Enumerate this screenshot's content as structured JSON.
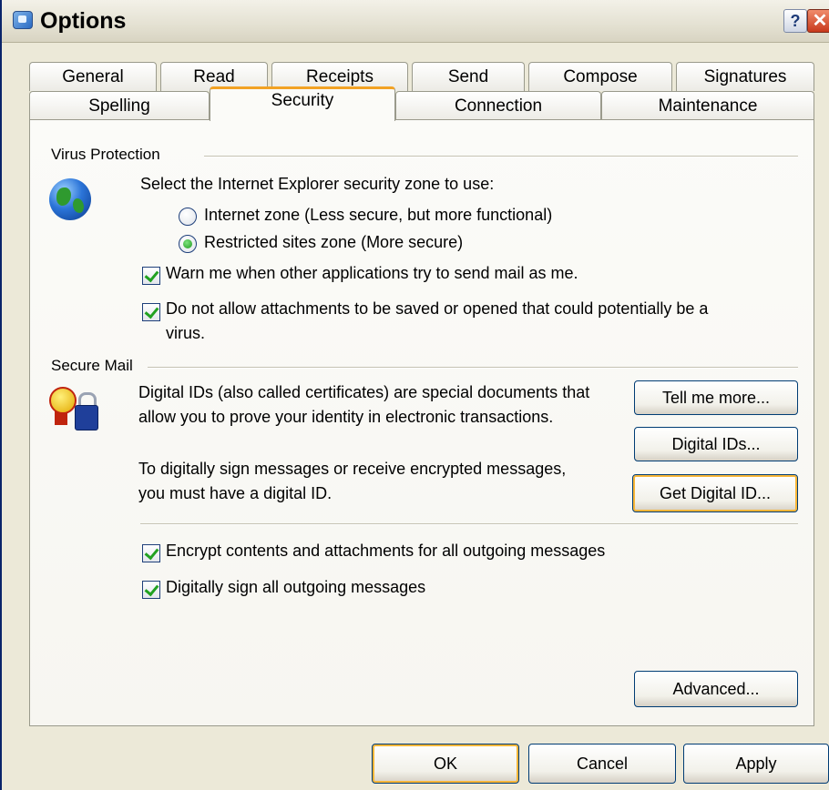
{
  "window": {
    "title": "Options",
    "help_glyph": "?",
    "close_glyph": "✕"
  },
  "tabs": {
    "row1": [
      "General",
      "Read",
      "Receipts",
      "Send",
      "Compose",
      "Signatures"
    ],
    "row2": [
      "Spelling",
      "Security",
      "Connection",
      "Maintenance"
    ],
    "active": "Security"
  },
  "virus_protection": {
    "heading": "Virus Protection",
    "icon": "globe-icon",
    "zone_prompt": "Select the Internet Explorer security zone to use:",
    "zones": [
      {
        "label": "Internet zone (Less secure, but more functional)",
        "selected": false
      },
      {
        "label": "Restricted sites zone (More secure)",
        "selected": true
      }
    ],
    "warn_label": "Warn me when other applications try to send mail as me.",
    "warn_checked": true,
    "attachments_label_line1": "Do not allow attachments to be saved or opened that could potentially be a",
    "attachments_label_line2": "virus.",
    "attachments_checked": true
  },
  "secure_mail": {
    "heading": "Secure Mail",
    "icon": "certificate-lock-icon",
    "desc1": "Digital IDs (also called certificates) are special documents that allow you to prove your identity in electronic transactions.",
    "desc2": "To digitally sign messages or receive encrypted messages, you must have a digital ID.",
    "tell_me_more": "Tell me more...",
    "digital_ids": "Digital IDs...",
    "get_digital_id": "Get Digital ID...",
    "encrypt_label": "Encrypt contents and attachments for all outgoing messages",
    "encrypt_checked": true,
    "sign_label": "Digitally sign all outgoing messages",
    "sign_checked": true
  },
  "advanced_label": "Advanced...",
  "footer": {
    "ok": "OK",
    "cancel": "Cancel",
    "apply": "Apply"
  },
  "colors": {
    "title_accent": "#0a246a",
    "active_tab_accent": "#f2a224",
    "check_green": "#21a121"
  }
}
